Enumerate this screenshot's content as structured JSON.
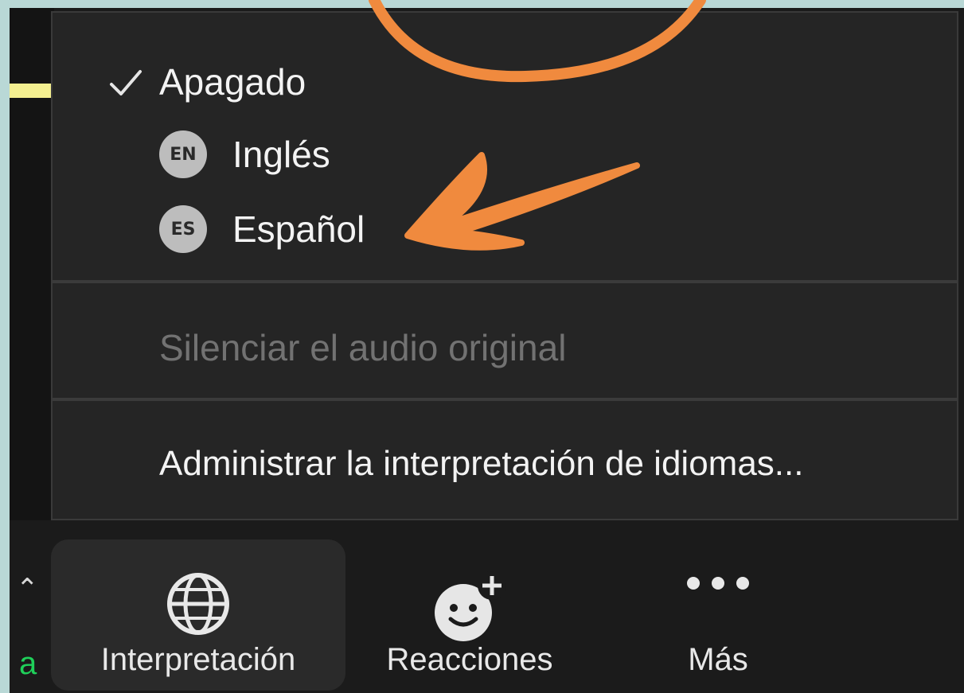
{
  "menu": {
    "items": [
      {
        "label": "Apagado",
        "checked": true
      },
      {
        "label": "Inglés",
        "badge": "EN"
      },
      {
        "label": "Español",
        "badge": "ES"
      }
    ],
    "mute_original": "Silenciar el audio original",
    "manage": "Administrar la interpretación de idiomas..."
  },
  "toolbar": {
    "left_partial_label": "a",
    "items": [
      {
        "label": "Interpretación",
        "icon": "globe-icon",
        "active": true
      },
      {
        "label": "Reacciones",
        "icon": "emoji-plus-icon"
      },
      {
        "label": "Más",
        "icon": "more-icon"
      }
    ]
  },
  "colors": {
    "annotation": "#f08a3e",
    "menu_bg": "#252525",
    "toolbar_bg": "#1b1b1b",
    "text": "#f3f3f3",
    "disabled_text": "#727272",
    "badge_bg": "#bdbdbd"
  }
}
